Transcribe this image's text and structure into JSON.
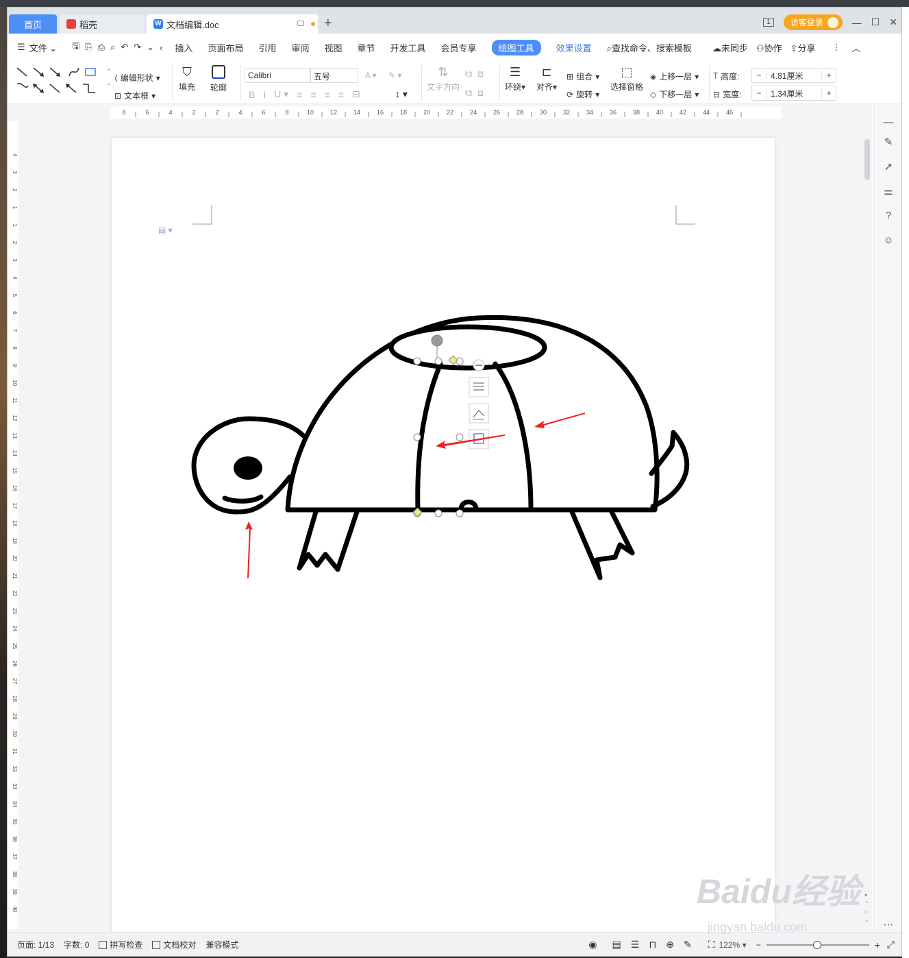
{
  "tabs": {
    "home": "首页",
    "daoke": "稻壳",
    "doc": "文档编辑.doc"
  },
  "window_controls": {
    "badge": "1",
    "login": "访客登录"
  },
  "menubar": {
    "file": "文件",
    "items": [
      "插入",
      "页面布局",
      "引用",
      "审阅",
      "视图",
      "章节",
      "开发工具",
      "会员专享"
    ],
    "active": "绘图工具",
    "effects": "效果设置",
    "search_placeholder": "查找命令、搜索模板",
    "unsynced": "未同步",
    "collab": "协作",
    "share": "分享"
  },
  "ribbon": {
    "edit_shape": "编辑形状",
    "text_box": "文本框",
    "fill": "填充",
    "outline": "轮廓",
    "font": "Calibri",
    "font_size": "五号",
    "text_direction": "文字方向",
    "wrap": "环绕",
    "align": "对齐",
    "group": "组合",
    "rotate": "旋转",
    "select_pane": "选择窗格",
    "bring_forward": "上移一层",
    "send_backward": "下移一层",
    "height_label": "高度:",
    "height_value": "4.81厘米",
    "width_label": "宽度:",
    "width_value": "1.34厘米"
  },
  "hruler_ticks": [
    "8",
    "6",
    "4",
    "2",
    "2",
    "4",
    "6",
    "8",
    "10",
    "12",
    "14",
    "16",
    "18",
    "20",
    "22",
    "24",
    "26",
    "28",
    "30",
    "32",
    "34",
    "36",
    "38",
    "40",
    "42",
    "44",
    "46"
  ],
  "vruler_ticks": [
    "4",
    "3",
    "2",
    "1",
    "1",
    "2",
    "3",
    "4",
    "5",
    "6",
    "7",
    "8",
    "9",
    "10",
    "11",
    "12",
    "13",
    "14",
    "15",
    "16",
    "17",
    "18",
    "19",
    "20",
    "21",
    "22",
    "23",
    "24",
    "25",
    "26",
    "27",
    "28",
    "29",
    "30",
    "31",
    "32",
    "33",
    "34",
    "35",
    "36",
    "37",
    "38",
    "39",
    "40"
  ],
  "statusbar": {
    "page": "页面: 1/13",
    "words": "字数: 0",
    "spell": "拼写检查",
    "proof": "文档校对",
    "compat": "兼容模式",
    "zoom": "122%"
  },
  "watermark": {
    "logo": "Baidu经验",
    "url": "jingyan.baidu.com"
  },
  "colors": {
    "accent": "#4f8ef7",
    "login": "#f5a623",
    "arrow": "#e8251f"
  }
}
